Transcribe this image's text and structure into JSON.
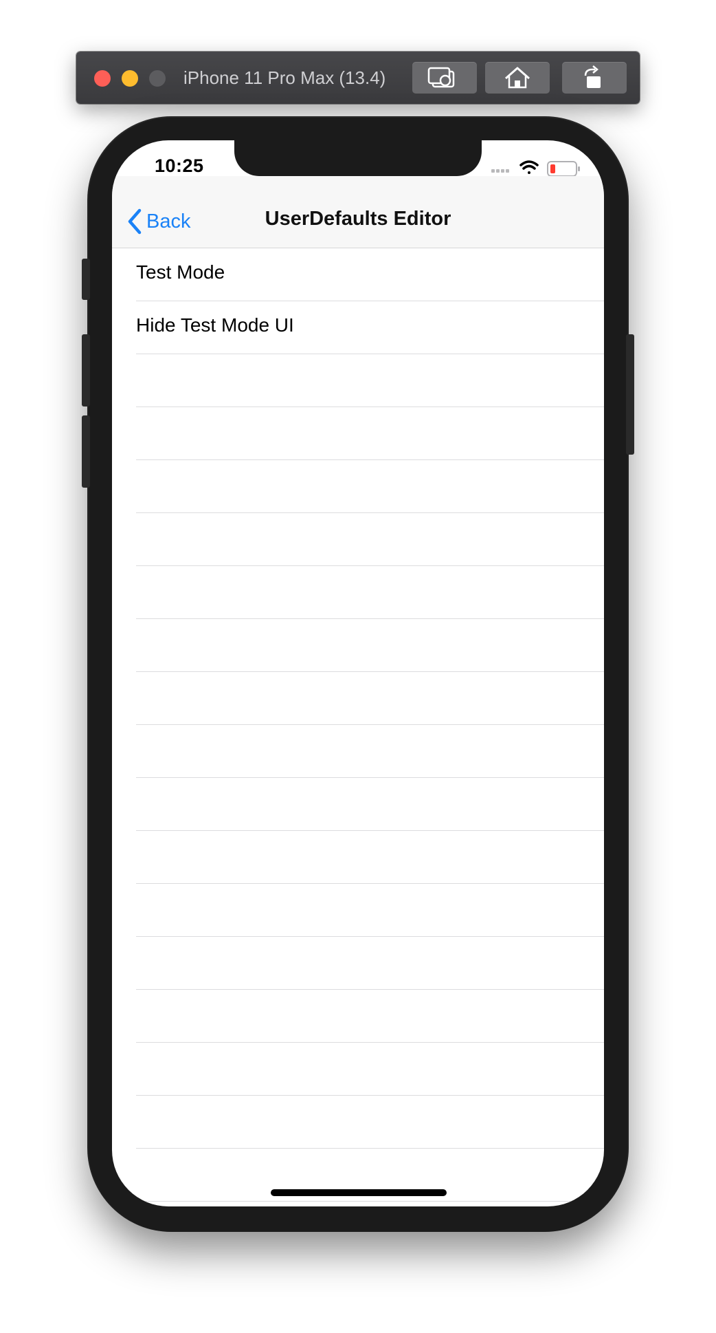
{
  "window": {
    "title": "iPhone 11 Pro Max (13.4)",
    "traffic_lights": [
      "close",
      "minimize",
      "zoom"
    ],
    "toolbar_buttons": [
      {
        "name": "screenshot-button",
        "icon": "camera-icon"
      },
      {
        "name": "home-button",
        "icon": "home-icon"
      },
      {
        "name": "rotate-button",
        "icon": "rotate-icon"
      }
    ]
  },
  "status_bar": {
    "time": "10:25",
    "icons": [
      "signal-icon",
      "wifi-icon",
      "battery-icon"
    ]
  },
  "navbar": {
    "back_label": "Back",
    "title": "UserDefaults Editor"
  },
  "settings": {
    "rows": [
      {
        "label": "Test Mode",
        "enabled": true
      },
      {
        "label": "Hide Test Mode UI",
        "enabled": false
      }
    ]
  },
  "colors": {
    "accent": "#1a82f7",
    "switch_on": "#34c759",
    "switch_off": "#e9e9eb"
  }
}
